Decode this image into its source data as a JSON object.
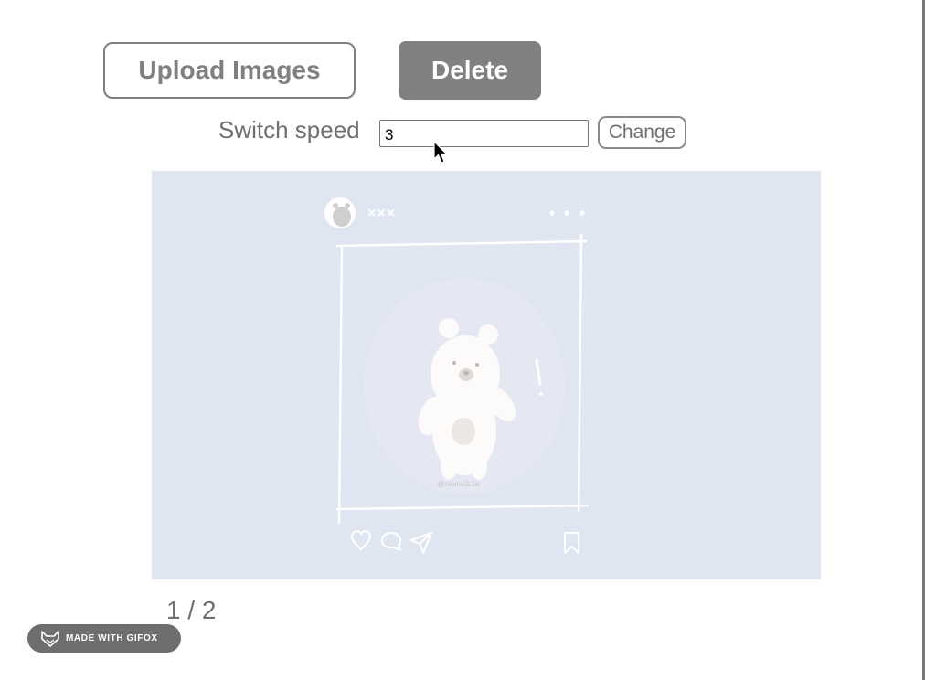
{
  "toolbar": {
    "upload_label": "Upload Images",
    "delete_label": "Delete"
  },
  "speed": {
    "label": "Switch speed",
    "value": "3",
    "change_label": "Change"
  },
  "slideshow": {
    "post_username": "×××",
    "watermark": "@momo2i.bk",
    "background_color": "#dfe6f1",
    "icons": [
      "heart-icon",
      "comment-icon",
      "send-icon",
      "bookmark-icon",
      "more-dots-icon",
      "avatar-icon"
    ]
  },
  "pagination": {
    "counter": "1 / 2"
  },
  "gifox": {
    "badge_text": "MADE WITH GIFOX"
  },
  "colors": {
    "button_gray": "#808080",
    "text_gray": "#707070",
    "slide_bg": "#dfe6f1"
  }
}
